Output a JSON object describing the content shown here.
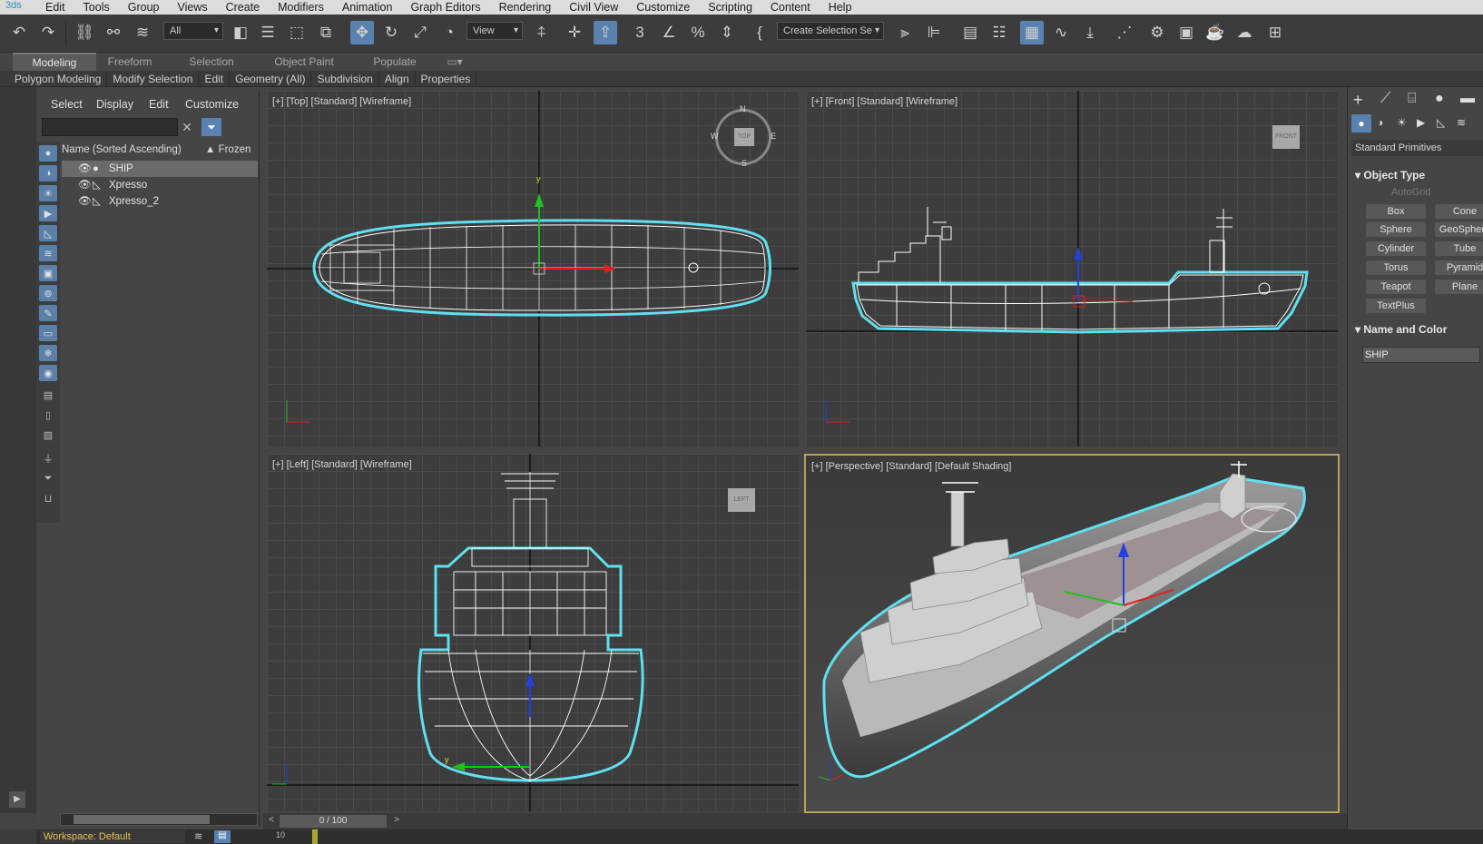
{
  "app": {
    "logo_text": "3ds"
  },
  "menu": [
    "Edit",
    "Tools",
    "Group",
    "Views",
    "Create",
    "Modifiers",
    "Animation",
    "Graph Editors",
    "Rendering",
    "Civil View",
    "Customize",
    "Scripting",
    "Content",
    "Help"
  ],
  "toolbar": {
    "filter_value": "All",
    "refcoord_value": "View",
    "selection_set_value": "Create Selection Se"
  },
  "ribbon": {
    "tabs": [
      "Modeling",
      "Freeform",
      "Selection",
      "Object Paint",
      "Populate"
    ],
    "panels": [
      "Polygon Modeling",
      "Modify Selection",
      "Edit",
      "Geometry (All)",
      "Subdivision",
      "Align",
      "Properties"
    ]
  },
  "explorer": {
    "menu": [
      "Select",
      "Display",
      "Edit",
      "Customize"
    ],
    "search_value": "",
    "col_name": "Name (Sorted Ascending)",
    "col_frozen": "▲ Frozen",
    "rows": [
      {
        "name": "SHIP",
        "selected": true,
        "icon": "geometry-sphere-icon"
      },
      {
        "name": "Xpresso",
        "selected": false,
        "icon": "helper-icon"
      },
      {
        "name": "Xpresso_2",
        "selected": false,
        "icon": "helper-icon"
      }
    ]
  },
  "viewports": {
    "top": {
      "label": "[+] [Top] [Standard] [Wireframe]",
      "cube_label": "TOP"
    },
    "front": {
      "label": "[+] [Front] [Standard] [Wireframe]",
      "cube_label": "FRONT"
    },
    "left": {
      "label": "[+] [Left] [Standard] [Wireframe]",
      "cube_label": "LEFT"
    },
    "persp": {
      "label": "[+] [Perspective] [Standard] [Default Shading]"
    },
    "compass": {
      "n": "N",
      "s": "S",
      "e": "E",
      "w": "W"
    }
  },
  "command_panel": {
    "category": "Standard Primitives",
    "object_type_title": "Object Type",
    "autogrid": "AutoGrid",
    "buttons": [
      "Box",
      "Cone",
      "Sphere",
      "GeoSphere",
      "Cylinder",
      "Tube",
      "Torus",
      "Pyramid",
      "Teapot",
      "Plane",
      "TextPlus"
    ],
    "name_color_title": "Name and Color",
    "name_value": "SHIP"
  },
  "timeline": {
    "frame_text": "0 / 100",
    "prev": "<",
    "next": ">"
  },
  "status": {
    "workspace": "Workspace: Default",
    "frame0": "10"
  },
  "colors": {
    "wire": "#ffffff",
    "selection": "#5fe0f0",
    "active_border": "#b8a25a",
    "axis_x": "#e02020",
    "axis_y": "#20c020",
    "axis_z": "#2040e0"
  }
}
